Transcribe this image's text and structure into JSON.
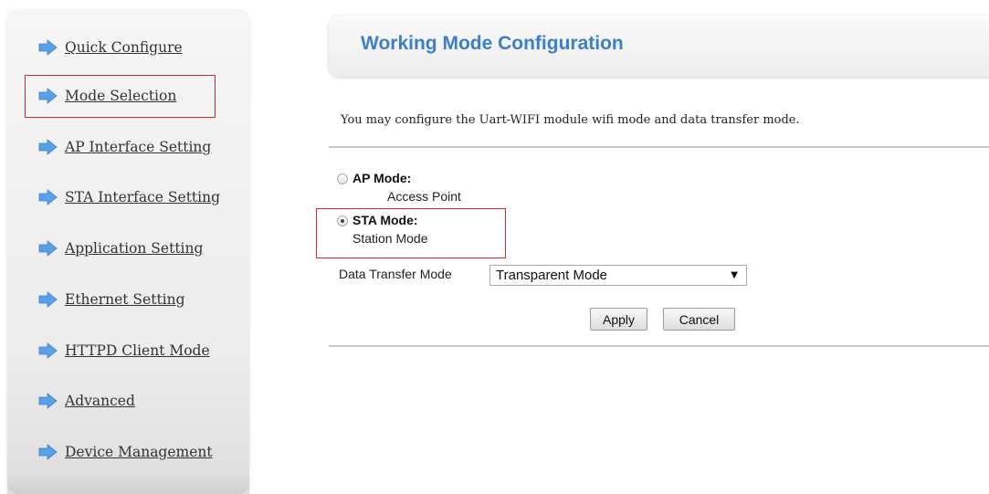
{
  "sidebar": {
    "items": [
      {
        "label": "Quick Configure"
      },
      {
        "label": "Mode Selection"
      },
      {
        "label": "AP Interface Setting"
      },
      {
        "label": "STA Interface Setting"
      },
      {
        "label": "Application Setting"
      },
      {
        "label": "Ethernet Setting"
      },
      {
        "label": "HTTPD Client Mode"
      },
      {
        "label": "Advanced"
      },
      {
        "label": "Device Management"
      }
    ],
    "icon": "arrow-right-icon",
    "icon_color": "#5aa0e8"
  },
  "header": {
    "title": "Working Mode Configuration",
    "color": "#3c7ec8"
  },
  "description": "You may configure the Uart-WIFI module wifi mode and data transfer mode.",
  "modes": {
    "ap": {
      "label": "AP Mode:",
      "sub": "Access Point",
      "checked": false
    },
    "sta": {
      "label": "STA Mode:",
      "sub": "Station Mode",
      "checked": true
    }
  },
  "data_transfer": {
    "label": "Data Transfer Mode",
    "value": "Transparent Mode"
  },
  "buttons": {
    "apply": "Apply",
    "cancel": "Cancel"
  },
  "highlight_color": "#d9262c"
}
